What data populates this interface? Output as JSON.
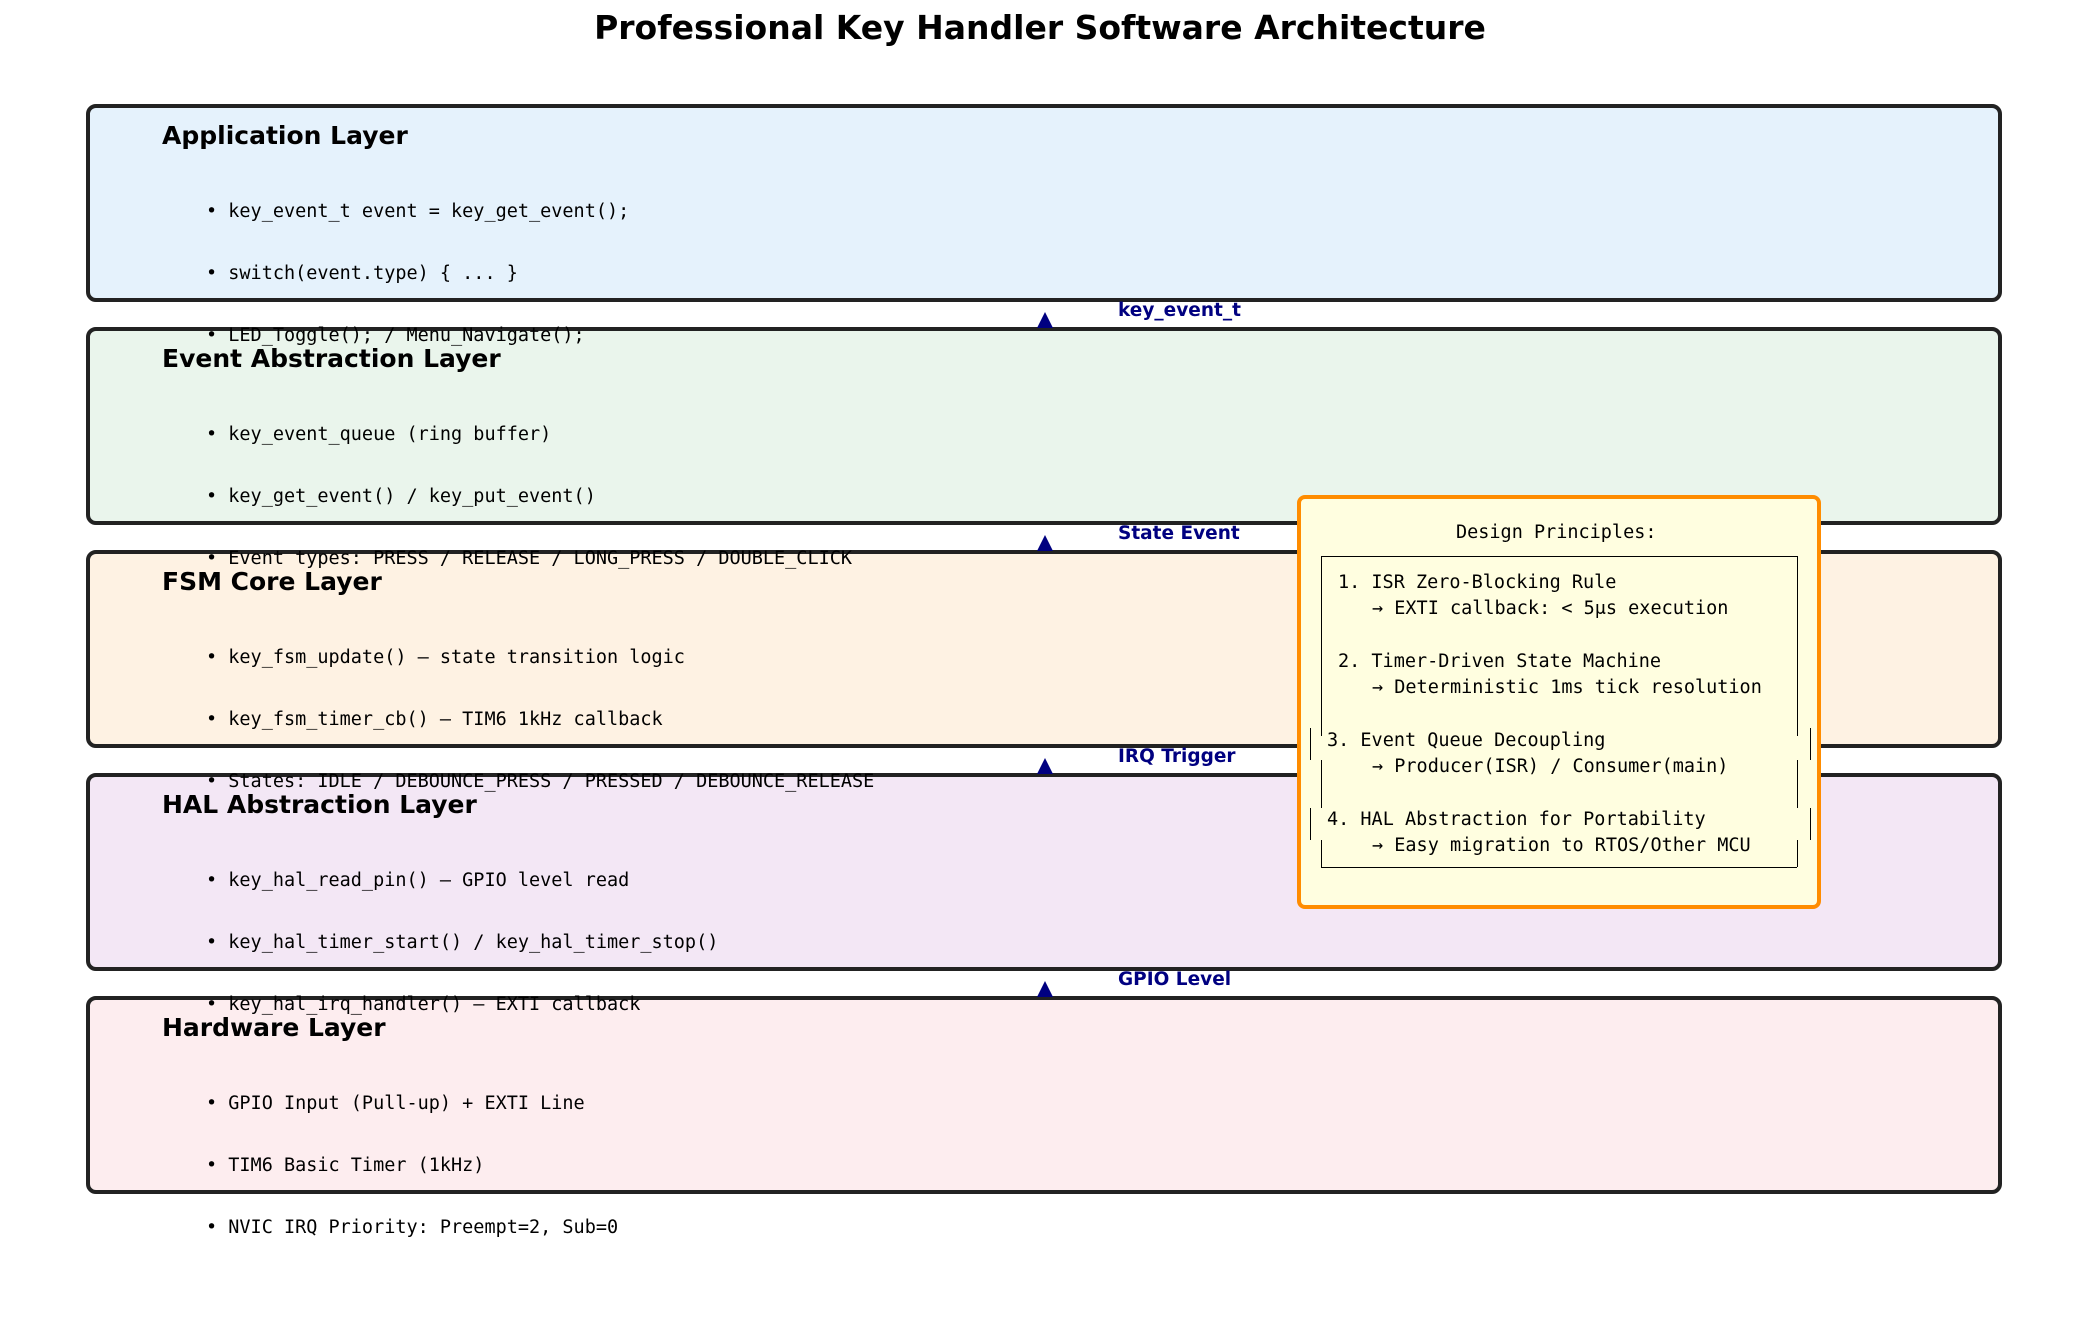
{
  "title": "Professional Key Handler Software Architecture",
  "colors": {
    "arrow": "#000080",
    "principles_border": "#ff8c00",
    "principles_fill": "#fffee0"
  },
  "layers": [
    {
      "title": "Application Layer",
      "fill": "#e5f2fc",
      "bullets": [
        "• key_event_t event = key_get_event();",
        "• switch(event.type) { ... }",
        "• LED_Toggle(); / Menu_Navigate();"
      ]
    },
    {
      "title": "Event Abstraction Layer",
      "fill": "#eaf5ec",
      "bullets": [
        "• key_event_queue (ring buffer)",
        "• key_get_event() / key_put_event()",
        "• Event types: PRESS / RELEASE / LONG_PRESS / DOUBLE_CLICK"
      ]
    },
    {
      "title": "FSM Core Layer",
      "fill": "#fef2e3",
      "bullets": [
        "• key_fsm_update() — state transition logic",
        "• key_fsm_timer_cb() — TIM6 1kHz callback",
        "• States: IDLE / DEBOUNCE_PRESS / PRESSED / DEBOUNCE_RELEASE"
      ]
    },
    {
      "title": "HAL Abstraction Layer",
      "fill": "#f3e7f5",
      "bullets": [
        "• key_hal_read_pin() — GPIO level read",
        "• key_hal_timer_start() / key_hal_timer_stop()",
        "• key_hal_irq_handler() — EXTI callback"
      ]
    },
    {
      "title": "Hardware Layer",
      "fill": "#fdedef",
      "bullets": [
        "• GPIO Input (Pull-up) + EXTI Line",
        "• TIM6 Basic Timer (1kHz)",
        "• NVIC IRQ Priority: Preempt=2, Sub=0"
      ]
    }
  ],
  "arrows": [
    {
      "label": "key_event_t"
    },
    {
      "label": "State Event"
    },
    {
      "label": "IRQ Trigger"
    },
    {
      "label": "GPIO Level"
    }
  ],
  "principles": {
    "heading": "Design Principles:",
    "items": [
      "1. ISR Zero-Blocking Rule",
      "→ EXTI callback: < 5μs execution",
      "2. Timer-Driven State Machine",
      "→ Deterministic 1ms tick resolution",
      "3. Event Queue Decoupling",
      "→ Producer(ISR) / Consumer(main)",
      "4. HAL Abstraction for Portability",
      "→ Easy migration to RTOS/Other MCU"
    ]
  }
}
